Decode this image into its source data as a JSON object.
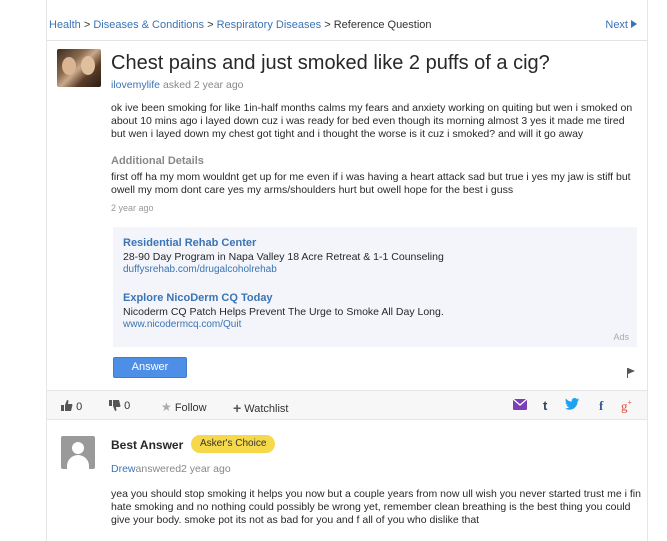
{
  "breadcrumb": {
    "items": [
      "Health",
      "Diseases & Conditions",
      "Respiratory Diseases"
    ],
    "current": "Reference Question",
    "separator": ">"
  },
  "nav": {
    "next_label": "Next"
  },
  "question": {
    "title": "Chest pains and just smoked like 2 puffs of a cig?",
    "asker": "ilovemylife",
    "asked_label": "asked 2 year ago",
    "body": "ok ive been smoking for like 1in-half months calms my fears and anxiety working on quiting but wen i smoked on about 10 mins ago i layed down cuz i was ready for bed even though its morning almost 3 yes it made me tired but wen i layed down my chest got tight and i thought the worse is it cuz i smoked? and will it go away",
    "additional_details_label": "Additional Details",
    "additional_details": "first off ha my mom wouldnt get up for me even if i was having a heart attack sad but true i yes my jaw is stiff but owell my mom dont care yes my arms/shoulders hurt but owell hope for the best i guss",
    "details_time": "2 year ago"
  },
  "ads": {
    "items": [
      {
        "title": "Residential Rehab Center",
        "desc": "28-90 Day Program in Napa Valley 18 Acre Retreat & 1-1 Counseling",
        "url": "duffysrehab.com/drugalcoholrehab"
      },
      {
        "title": "Explore NicoDerm CQ Today",
        "desc": "Nicoderm CQ Patch Helps Prevent The Urge to Smoke All Day Long.",
        "url": "www.nicodermcq.com/Quit"
      }
    ],
    "label": "Ads"
  },
  "answer_button": "Answer",
  "actions": {
    "thumbs_up_count": "0",
    "thumbs_down_count": "0",
    "follow_label": "Follow",
    "watchlist_label": "Watchlist",
    "share_icons": [
      "mail-icon",
      "tumblr-icon",
      "twitter-icon",
      "facebook-icon",
      "google-plus-icon"
    ]
  },
  "best_answer": {
    "heading": "Best Answer",
    "badge": "Asker's Choice",
    "author": "Drew",
    "answered_label": "answered2 year ago",
    "body": "yea you should stop smoking it helps you now but a couple years from now ull wish you never started trust me i fin hate smoking and no nothing could possibly be wrong yet, remember clean breathing is the best thing you could give your body. smoke pot its not as bad for you and f all of you who dislike that"
  },
  "colors": {
    "link": "#3a74b4",
    "answer_button": "#4d8ee7",
    "badge": "#f6d94a",
    "ad_background": "#f3f5fa"
  }
}
